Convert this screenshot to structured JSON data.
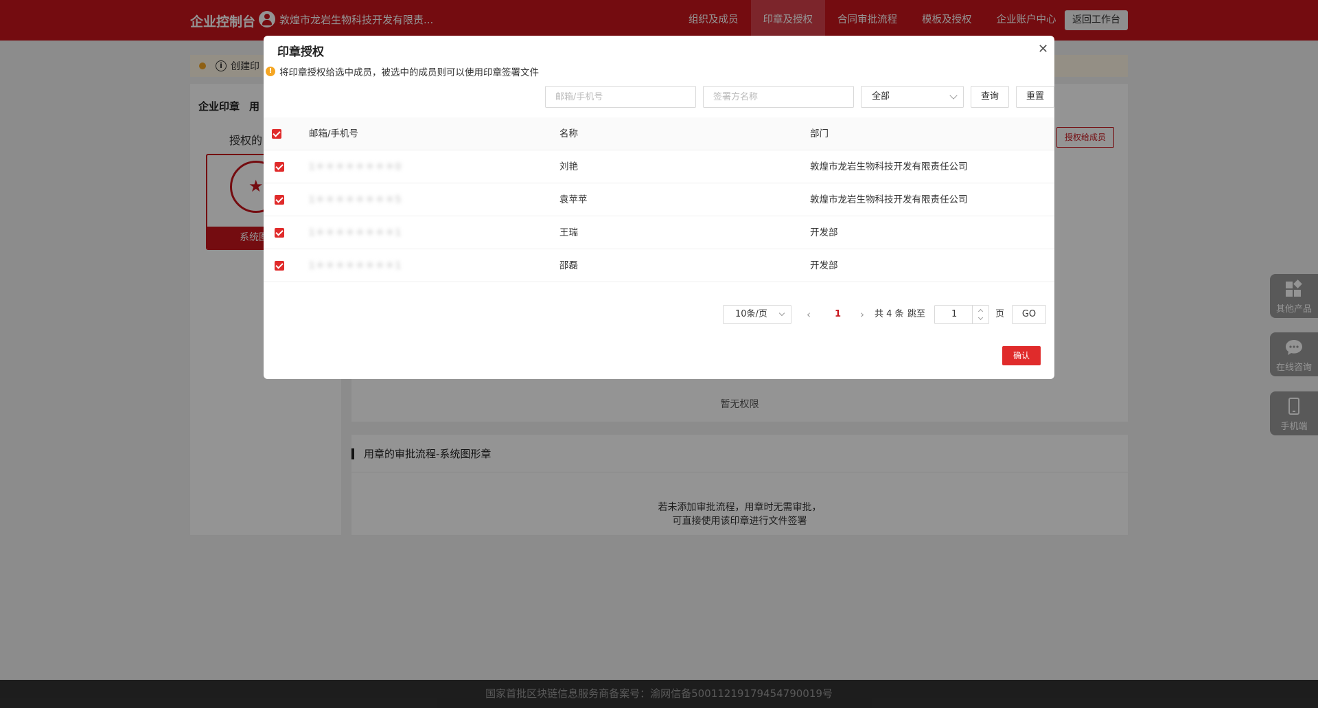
{
  "topnav": {
    "brand": "企业控制台",
    "company": "敦煌市龙岩生物科技开发有限责...",
    "menu": [
      {
        "label": "组织及成员",
        "active": false
      },
      {
        "label": "印章及授权",
        "active": true
      },
      {
        "label": "合同审批流程",
        "active": false
      },
      {
        "label": "模板及授权",
        "active": false
      },
      {
        "label": "企业账户中心",
        "active": false
      }
    ],
    "back_label": "返回工作台"
  },
  "background": {
    "notice_text": "创建印",
    "left_tabs": [
      "企业印章",
      "用"
    ],
    "left_label": "授权的",
    "seal_name": "系统图",
    "auth_button": "授权给成员",
    "no_permission": "暂无权限",
    "approval_title": "用章的审批流程-系统图形章",
    "approval_text_1": "若未添加审批流程，用章时无需审批，",
    "approval_text_2": "可直接使用该印章进行文件签署",
    "footer": "国家首批区块链信息服务商备案号：渝网信备50011219179454790019号"
  },
  "side_float": [
    {
      "label": "其他产品",
      "icon": "apps-icon"
    },
    {
      "label": "在线咨询",
      "icon": "chat-icon"
    },
    {
      "label": "手机端",
      "icon": "mobile-icon"
    }
  ],
  "modal": {
    "title": "印章授权",
    "description": "将印章授权给选中成员，被选中的成员则可以使用印章签署文件",
    "filters": {
      "email_placeholder": "邮箱/手机号",
      "name_placeholder": "签署方名称",
      "select_value": "全部",
      "query_label": "查询",
      "reset_label": "重置"
    },
    "table": {
      "headers": {
        "email": "邮箱/手机号",
        "name": "名称",
        "dept": "部门"
      },
      "rows": [
        {
          "email": "1＊＊＊＊＊＊＊＊0",
          "name": "刘艳",
          "dept": "敦煌市龙岩生物科技开发有限责任公司",
          "checked": true
        },
        {
          "email": "1＊＊＊＊＊＊＊＊5",
          "name": "袁苹苹",
          "dept": "敦煌市龙岩生物科技开发有限责任公司",
          "checked": true
        },
        {
          "email": "1＊＊＊＊＊＊＊＊1",
          "name": "王瑞",
          "dept": "开发部",
          "checked": true
        },
        {
          "email": "1＊＊＊＊＊＊＊＊1",
          "name": "邵磊",
          "dept": "开发部",
          "checked": true
        }
      ]
    },
    "pagination": {
      "page_size": "10条/页",
      "current_page": "1",
      "total": "共 4 条",
      "jump_label": "跳至",
      "jump_value": "1",
      "page_unit": "页",
      "go_label": "GO"
    },
    "confirm_label": "确认"
  },
  "colors": {
    "brand_red": "#c8161d",
    "check_red": "#e02b2b",
    "warn_orange": "#f5a623"
  }
}
